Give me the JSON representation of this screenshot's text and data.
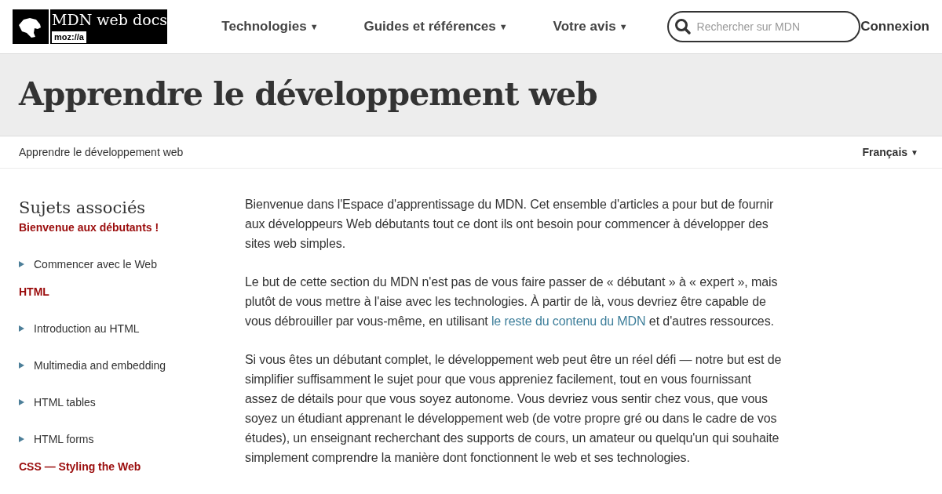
{
  "header": {
    "logo": {
      "title": "MDN web docs",
      "subtitle": "moz://a"
    },
    "nav": [
      {
        "label": "Technologies",
        "caret": "▼"
      },
      {
        "label": "Guides et références",
        "caret": "▼"
      },
      {
        "label": "Votre avis",
        "caret": "▼"
      }
    ],
    "search": {
      "placeholder": "Rechercher sur MDN"
    },
    "login": "Connexion"
  },
  "page_title": "Apprendre le développement web",
  "breadcrumb": "Apprendre le développement web",
  "language": {
    "label": "Français",
    "caret": "▼"
  },
  "sidebar": {
    "title": "Sujets associés",
    "sections": [
      {
        "title": "Bienvenue aux débutants !",
        "items": [
          {
            "label": "Commencer avec le Web",
            "expanded": false
          }
        ]
      },
      {
        "title": "HTML",
        "items": [
          {
            "label": "Introduction au HTML",
            "expanded": false
          },
          {
            "label": "Multimedia and embedding",
            "expanded": false
          },
          {
            "label": "HTML tables",
            "expanded": false
          },
          {
            "label": "HTML forms",
            "expanded": false
          }
        ]
      },
      {
        "title": "CSS — Styling the Web"
      }
    ]
  },
  "paragraphs": [
    [
      {
        "kind": "text",
        "text": "Bienvenue dans l'Espace d'apprentissage du MDN. Cet ensemble d'articles a pour but de fournir aux développeurs Web débutants tout ce dont ils ont besoin pour commencer à développer des sites web simples."
      }
    ],
    [
      {
        "kind": "text",
        "text": "Le but de cette section du MDN n'est pas de vous faire passer de « débutant » à « expert », mais plutôt de vous mettre à l'aise avec les technologies. À partir de là, vous devriez être capable de vous débrouiller par vous-même, en utilisant "
      },
      {
        "kind": "link",
        "text": "le reste du contenu du MDN"
      },
      {
        "kind": "text",
        "text": " et d'autres ressources."
      }
    ],
    [
      {
        "kind": "text",
        "text": "Si vous êtes un débutant complet, le développement web peut être un réel défi — notre but est de simplifier suffisamment le sujet pour que vous appreniez facilement, tout en vous fournissant assez de détails pour que vous soyez autonome. Vous devriez vous sentir chez vous, que vous soyez un étudiant apprenant le développement web (de votre propre gré ou dans le cadre de vos études), un enseignant recherchant des supports de cours, un amateur ou quelqu'un qui souhaite simplement comprendre la manière dont fonctionnent le web et ses technologies."
      }
    ]
  ]
}
